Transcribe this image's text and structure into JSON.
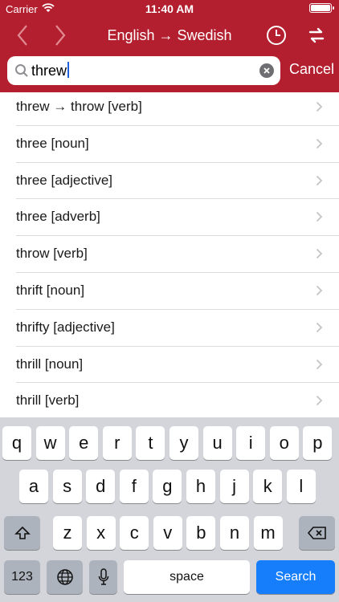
{
  "status_bar": {
    "carrier": "Carrier",
    "time": "11:40 AM"
  },
  "nav": {
    "title": "English → Swedish",
    "back_icon": "chevron-left-icon",
    "forward_icon": "chevron-right-icon",
    "history_icon": "clock-icon",
    "swap_icon": "swap-icon"
  },
  "search": {
    "value": "threw",
    "cancel_label": "Cancel"
  },
  "results": [
    "threw → throw [verb]",
    "three [noun]",
    "three [adjective]",
    "three [adverb]",
    "throw [verb]",
    "thrift [noun]",
    "thrifty [adjective]",
    "thrill [noun]",
    "thrill [verb]"
  ],
  "keyboard": {
    "row1": [
      "q",
      "w",
      "e",
      "r",
      "t",
      "y",
      "u",
      "i",
      "o",
      "p"
    ],
    "row2": [
      "a",
      "s",
      "d",
      "f",
      "g",
      "h",
      "j",
      "k",
      "l"
    ],
    "row3": [
      "z",
      "x",
      "c",
      "v",
      "b",
      "n",
      "m"
    ],
    "numbers_label": "123",
    "space_label": "space",
    "search_label": "Search"
  },
  "colors": {
    "header": "#b31f2e",
    "accent_blue": "#167efb",
    "keyboard_bg": "#d3d5db"
  }
}
